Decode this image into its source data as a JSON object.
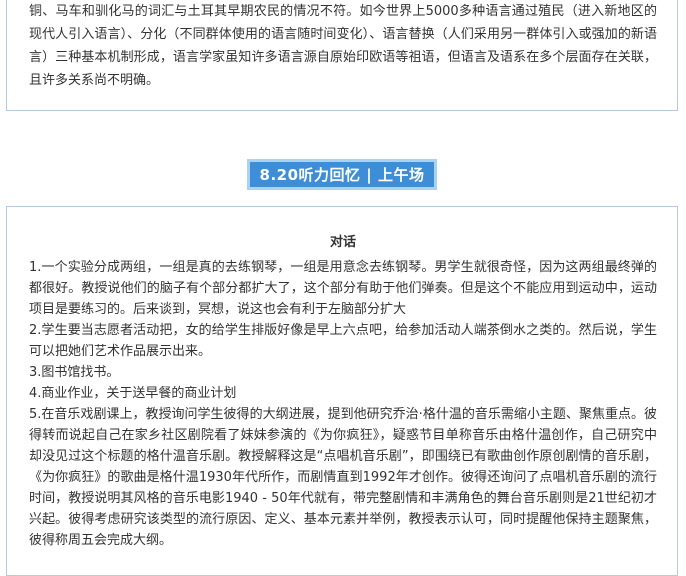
{
  "top_section": {
    "paragraph": "铜、马车和驯化马的词汇与土耳其早期农民的情况不符。如今世界上5000多种语言通过殖民（进入新地区的现代人引入语言）、分化（不同群体使用的语言随时间变化）、语言替换（人们采用另一群体引入或强加的新语言）三种基本机制形成，语言学家虽知许多语言源自原始印欧语等祖语，但语言及语系在多个层面存在关联，且许多关系尚不明确。"
  },
  "section_heading": {
    "label": "8.20听力回忆 | 上午场"
  },
  "dialog_section": {
    "title": "对话",
    "items": [
      "1.一个实验分成两组，一组是真的去练钢琴，一组是用意念去练钢琴。男学生就很奇怪，因为这两组最终弹的都很好。教授说他们的脑子有个部分都扩大了，这个部分有助于他们弹奏。但是这个不能应用到运动中，运动项目是要练习的。后来谈到，冥想，说这也会有利于左脑部分扩大",
      "2.学生要当志愿者活动把，女的给学生排版好像是早上六点吧，给参加活动人端茶倒水之类的。然后说，学生可以把她们艺术作品展示出来。",
      "3.图书馆找书。",
      "4.商业作业，关于送早餐的商业计划",
      "5.在音乐戏剧课上，教授询问学生彼得的大纲进展，提到他研究乔治·格什温的音乐需缩小主题、聚焦重点。彼得转而说起自己在家乡社区剧院看了妹妹参演的《为你疯狂》，疑惑节目单称音乐由格什温创作，自己研究中却没见过这个标题的格什温音乐剧。教授解释这是“点唱机音乐剧”，即围绕已有歌曲创作原创剧情的音乐剧，《为你疯狂》的歌曲是格什温1930年代所作，而剧情直到1992年才创作。彼得还询问了点唱机音乐剧的流行时间，教授说明其风格的音乐电影1940 - 50年代就有，带完整剧情和丰满角色的舞台音乐剧则是21世纪初才兴起。彼得考虑研究该类型的流行原因、定义、基本元素并举例，教授表示认可，同时提醒他保持主题聚焦，彼得称周五会完成大纲。"
    ]
  }
}
